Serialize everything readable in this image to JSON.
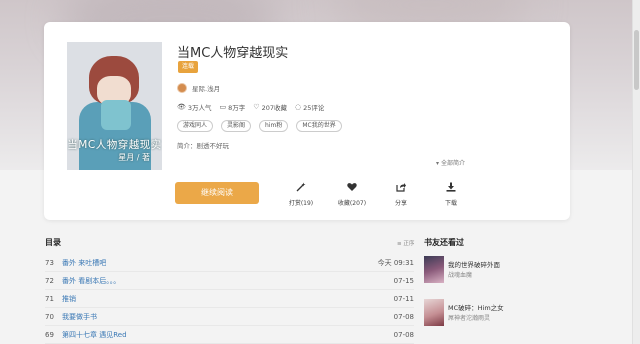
{
  "book": {
    "title": "当MC人物穿越现实",
    "status": "连载",
    "author": "星际.浅月",
    "stats": {
      "popularity": "3万人气",
      "words": "8万字",
      "favorites": "207收藏",
      "comments": "25评论"
    },
    "tags": [
      "游戏同人",
      "灵影阁",
      "him粉",
      "MC我的世界"
    ],
    "intro": "简介：剧透不好玩",
    "expand_label": "全部简介",
    "cover_title": "当MC人物穿越现实",
    "cover_author": "星月 / 著"
  },
  "actions": {
    "read_label": "继续阅读",
    "reward_label": "打赏(19)",
    "favorite_label": "收藏(207)",
    "share_label": "分享",
    "download_label": "下载"
  },
  "toc": {
    "heading": "目录",
    "sort_label": "正序",
    "chapters": [
      {
        "num": "73",
        "title": "番外 来吐槽吧",
        "date": "今天 09:31"
      },
      {
        "num": "72",
        "title": "番外 看剧本后。。。",
        "date": "07-15"
      },
      {
        "num": "71",
        "title": "推销",
        "date": "07-11"
      },
      {
        "num": "70",
        "title": "我要做手书",
        "date": "07-08"
      },
      {
        "num": "69",
        "title": "第四十七章 遇见Red",
        "date": "07-08"
      }
    ]
  },
  "sidebar": {
    "heading": "书友还看过",
    "items": [
      {
        "title": "我的世界破碎外面",
        "author": "战魂血魔"
      },
      {
        "title": "MC破碎：Him之女",
        "author": "屌神者沱瀚雨灵"
      }
    ]
  },
  "colors": {
    "accent": "#eba848",
    "link": "#3a78b5",
    "status_badge": "#e8a33d"
  },
  "icons": {
    "popularity": "eye-icon",
    "words": "document-icon",
    "favorites": "heart-icon",
    "comments": "comment-icon",
    "reward": "magic-wand-icon",
    "favorite": "heart-icon",
    "share": "share-icon",
    "download": "download-icon"
  }
}
